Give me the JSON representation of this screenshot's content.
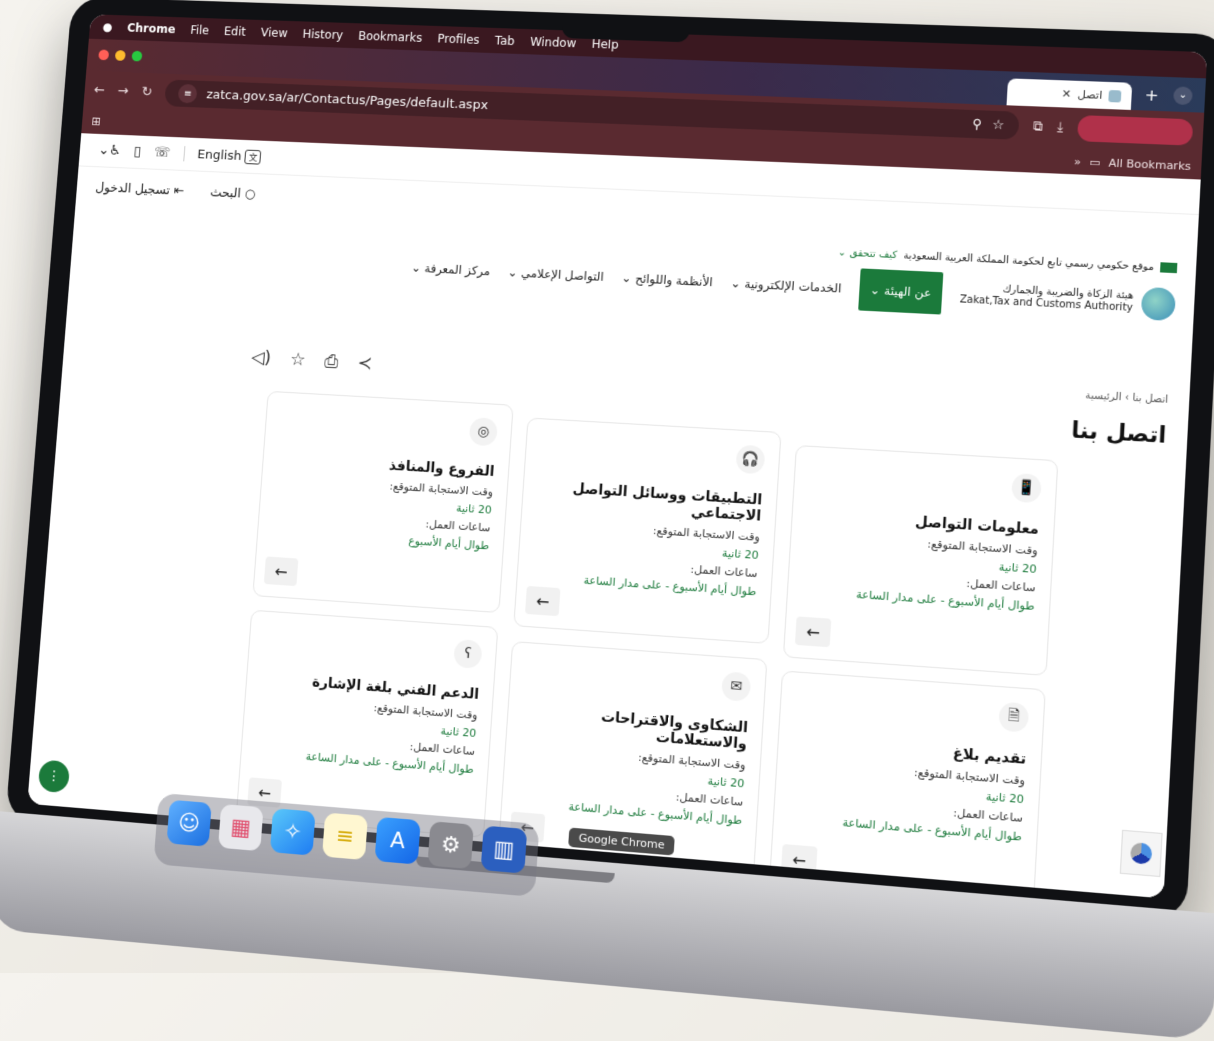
{
  "mac_menu": {
    "apple": "",
    "app": "Chrome",
    "items": [
      "File",
      "Edit",
      "View",
      "History",
      "Bookmarks",
      "Profiles",
      "Tab",
      "Window",
      "Help"
    ]
  },
  "tab": {
    "title": "اتصل"
  },
  "address": {
    "url": "zatca.gov.sa/ar/Contactus/Pages/default.aspx"
  },
  "bookmarks": {
    "all_label": "All Bookmarks"
  },
  "util": {
    "lang": "English",
    "lang_icon": "文"
  },
  "header": {
    "login": "تسجيل الدخول",
    "search": "البحث"
  },
  "gov": {
    "text": "موقع حكومي رسمي تابع لحكومة المملكة العربية السعودية",
    "verify": "كيف تتحقق"
  },
  "nav": {
    "items": [
      "مركز المعرفة",
      "التواصل الإعلامي",
      "الأنظمة واللوائح",
      "الخدمات الإلكترونية",
      "عن الهيئة"
    ]
  },
  "logo": {
    "ar": "هيئة الزكاة والضريبة والجمارك",
    "en": "Zakat,Tax and Customs Authority"
  },
  "breadcrumb": {
    "home": "الرئيسية",
    "sep": "›",
    "current": "اتصل بنا"
  },
  "page_title": "اتصل بنا",
  "cards": [
    {
      "title": "معلومات التواصل",
      "icon": "📱",
      "resp_label": "وقت الاستجابة المتوقع:",
      "resp_value": "20 ثانية",
      "hours_label": "ساعات العمل:",
      "hours_value": "طوال أيام الأسبوع - على مدار الساعة"
    },
    {
      "title": "التطبيقات ووسائل التواصل الاجتماعي",
      "icon": "🎧",
      "resp_label": "وقت الاستجابة المتوقع:",
      "resp_value": "20 ثانية",
      "hours_label": "ساعات العمل:",
      "hours_value": "طوال أيام الأسبوع - على مدار الساعة"
    },
    {
      "title": "الفروع والمنافذ",
      "icon": "◎",
      "resp_label": "وقت الاستجابة المتوقع:",
      "resp_value": "20 ثانية",
      "hours_label": "ساعات العمل:",
      "hours_value": "طوال أيام الأسبوع"
    },
    {
      "title": "تقديم بلاغ",
      "icon": "🗎",
      "resp_label": "وقت الاستجابة المتوقع:",
      "resp_value": "20 ثانية",
      "hours_label": "ساعات العمل:",
      "hours_value": "طوال أيام الأسبوع - على مدار الساعة"
    },
    {
      "title": "الشكاوى والاقتراحات والاستعلامات",
      "icon": "✉",
      "resp_label": "وقت الاستجابة المتوقع:",
      "resp_value": "20 ثانية",
      "hours_label": "ساعات العمل:",
      "hours_value": "طوال أيام الأسبوع - على مدار الساعة"
    },
    {
      "title": "الدعم الفني بلغة الإشارة",
      "icon": "ʕ",
      "resp_label": "وقت الاستجابة المتوقع:",
      "resp_value": "20 ثانية",
      "hours_label": "ساعات العمل:",
      "hours_value": "طوال أيام الأسبوع - على مدار الساعة"
    }
  ],
  "tooltip": "Google Chrome",
  "colors": {
    "brand_green": "#1b7a3b",
    "chrome_frame": "#5a2a30"
  }
}
